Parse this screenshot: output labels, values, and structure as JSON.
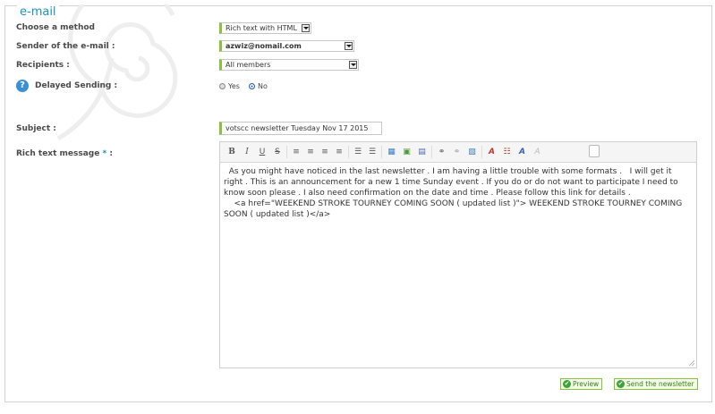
{
  "fieldset": {
    "legend": "e-mail"
  },
  "form": {
    "method_label": "Choose a method",
    "method_value": "Rich text with HTML",
    "sender_label": "Sender of the e-mail :",
    "sender_value": "azwiz@nomail.com",
    "recipients_label": "Recipients :",
    "recipients_value": "All members",
    "delayed_label": "Delayed Sending :",
    "help_glyph": "?",
    "delayed_yes": "Yes",
    "delayed_no": "No",
    "delayed_selected": "No",
    "subject_label": "Subject :",
    "subject_value": "votscc newsletter Tuesday Nov 17 2015",
    "message_label": "Rich text message",
    "required_mark": "*",
    "message_colon": ":"
  },
  "editor": {
    "content": "  As you might have noticed in the last newsletter . I am having a little trouble with some formats .   I will get it right . This is an announcement for a new 1 time Sunday event . If you do or do not want to participate I need to know soon please . I also need confirmation on the date and time . Please follow this link for details .\n    <a href=\"WEEKEND STROKE TOURNEY COMING SOON ( updated list )\"> WEEKEND STROKE TOURNEY COMING SOON ( updated list )</a>",
    "toolbar": [
      {
        "name": "bold-button",
        "glyph": "B",
        "icon": "bold-icon"
      },
      {
        "name": "italic-button",
        "glyph": "I",
        "icon": "italic-icon"
      },
      {
        "name": "underline-button",
        "glyph": "U",
        "icon": "underline-icon"
      },
      {
        "name": "strikethrough-button",
        "glyph": "S",
        "icon": "strikethrough-icon"
      },
      {
        "name": "align-left-button",
        "glyph": "≡",
        "icon": "align-left-icon"
      },
      {
        "name": "align-center-button",
        "glyph": "≡",
        "icon": "align-center-icon"
      },
      {
        "name": "align-right-button",
        "glyph": "≡",
        "icon": "align-right-icon"
      },
      {
        "name": "align-justify-button",
        "glyph": "≡",
        "icon": "align-justify-icon"
      },
      {
        "name": "bullet-list-button",
        "glyph": "☰",
        "icon": "bullet-list-icon"
      },
      {
        "name": "numbered-list-button",
        "glyph": "☰",
        "icon": "numbered-list-icon"
      },
      {
        "name": "insert-table-button",
        "glyph": "▦",
        "icon": "table-icon"
      },
      {
        "name": "insert-image-button",
        "glyph": "▣",
        "icon": "image-icon"
      },
      {
        "name": "insert-media-button",
        "glyph": "▤",
        "icon": "media-icon"
      },
      {
        "name": "insert-link-button",
        "glyph": "⚭",
        "icon": "link-icon"
      },
      {
        "name": "unlink-button",
        "glyph": "⚭",
        "icon": "unlink-icon"
      },
      {
        "name": "anchor-button",
        "glyph": "▧",
        "icon": "anchor-icon"
      },
      {
        "name": "text-color-button",
        "glyph": "A",
        "icon": "text-color-icon"
      },
      {
        "name": "highlight-button",
        "glyph": "☷",
        "icon": "highlight-icon"
      },
      {
        "name": "font-style-button",
        "glyph": "A",
        "icon": "font-style-icon"
      },
      {
        "name": "remove-format-button",
        "glyph": "A",
        "icon": "remove-format-icon"
      }
    ]
  },
  "actions": {
    "preview": "Preview",
    "send": "Send the newsletter"
  },
  "colors": {
    "accent": "#1c8fc2",
    "field_border_left": "#86c43b",
    "button_border": "#86c43b",
    "button_text": "#3b7f1a"
  }
}
